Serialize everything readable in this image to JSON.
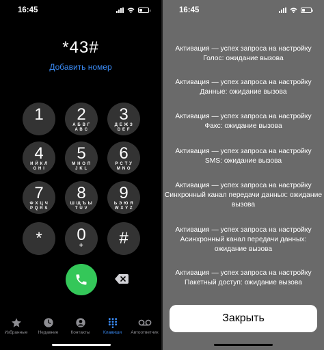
{
  "left": {
    "status": {
      "time": "16:45"
    },
    "dialed_number": "*43#",
    "add_number_label": "Добавить номер",
    "keypad": [
      {
        "digit": "1",
        "sub": ""
      },
      {
        "digit": "2",
        "sub": "А Б В Г",
        "sub2": "A B C"
      },
      {
        "digit": "3",
        "sub": "Д Е Ж З",
        "sub2": "D E F"
      },
      {
        "digit": "4",
        "sub": "И Й К Л",
        "sub2": "G H I"
      },
      {
        "digit": "5",
        "sub": "М Н О П",
        "sub2": "J K L"
      },
      {
        "digit": "6",
        "sub": "Р С Т У",
        "sub2": "M N O"
      },
      {
        "digit": "7",
        "sub": "Ф Х Ц Ч",
        "sub2": "P Q R S"
      },
      {
        "digit": "8",
        "sub": "Ш Щ Ъ Ы",
        "sub2": "T U V"
      },
      {
        "digit": "9",
        "sub": "Ь Э Ю Я",
        "sub2": "W X Y Z"
      },
      {
        "digit": "*",
        "sub": ""
      },
      {
        "digit": "0",
        "sub": "+"
      },
      {
        "digit": "#",
        "sub": ""
      }
    ],
    "tabs": [
      {
        "label": "Избранные",
        "icon": "star-icon"
      },
      {
        "label": "Недавние",
        "icon": "clock-icon"
      },
      {
        "label": "Контакты",
        "icon": "contact-icon"
      },
      {
        "label": "Клавиши",
        "icon": "keypad-icon",
        "active": true
      },
      {
        "label": "Автоответчик",
        "icon": "voicemail-icon"
      }
    ],
    "colors": {
      "accent": "#3b8cf6",
      "call": "#34c759",
      "key_bg": "#333333"
    }
  },
  "right": {
    "status": {
      "time": "16:45"
    },
    "messages": [
      {
        "line1": "Активация — успех запроса на настройку",
        "line2": "Голос: ожидание вызова"
      },
      {
        "line1": "Активация — успех запроса на настройку",
        "line2": "Данные: ожидание вызова"
      },
      {
        "line1": "Активация — успех запроса на настройку",
        "line2": "Факс: ожидание вызова"
      },
      {
        "line1": "Активация — успех запроса на настройку",
        "line2": "SMS: ожидание вызова"
      },
      {
        "line1": "Активация — успех запроса на настройку",
        "line2": "Синхронный канал передачи данных: ожидание",
        "line3": "вызова"
      },
      {
        "line1": "Активация — успех запроса на настройку",
        "line2": "Асинхронный канал передачи данных:",
        "line3": "ожидание вызова"
      },
      {
        "line1": "Активация — успех запроса на настройку",
        "line2": "Пакетный доступ: ожидание вызова"
      }
    ],
    "close_label": "Закрыть",
    "colors": {
      "overlay": "#6a6a6a"
    }
  }
}
